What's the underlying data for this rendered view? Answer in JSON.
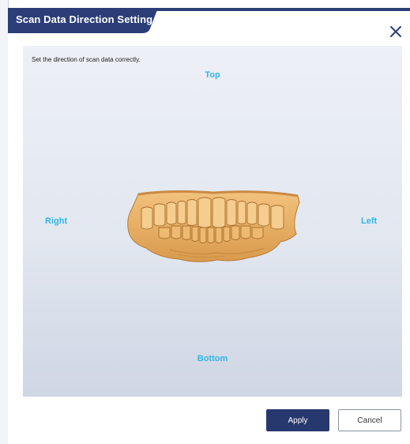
{
  "dialog": {
    "title": "Scan Data Direction Setting",
    "close_icon": "close-icon",
    "instruction": "Set the direction of scan data correctly."
  },
  "viewport": {
    "directions": {
      "top": "Top",
      "bottom": "Bottom",
      "right": "Right",
      "left": "Left"
    },
    "model": "dental-arch-3d-model"
  },
  "footer": {
    "apply_label": "Apply",
    "cancel_label": "Cancel"
  },
  "colors": {
    "title_bar": "#2c3e78",
    "direction_label": "#33b5e5",
    "apply_button": "#26386e",
    "model": "#e8b067"
  }
}
